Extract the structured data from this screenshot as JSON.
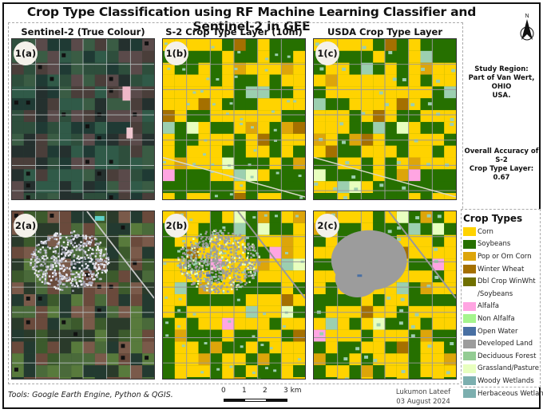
{
  "title": "Crop Type Classification using RF Machine Learning Classifier and Sentinel-2 in GEE",
  "north_arrow": {
    "label": "N",
    "icon": "north-arrow-icon"
  },
  "columns": [
    {
      "title": "Sentinel-2 (True Colour)"
    },
    {
      "title": "S-2 Crop Type Layer (10m)"
    },
    {
      "title": "USDA Crop Type Layer (30m)"
    }
  ],
  "panels": [
    {
      "label": "1(a)",
      "row": 1,
      "col": "a",
      "kind": "true-colour",
      "area": "rural fields"
    },
    {
      "label": "1(b)",
      "row": 1,
      "col": "b",
      "kind": "s2-classified",
      "area": "rural fields"
    },
    {
      "label": "1(c)",
      "row": 1,
      "col": "c",
      "kind": "usda-classified",
      "area": "rural fields"
    },
    {
      "label": "2(a)",
      "row": 2,
      "col": "a",
      "kind": "true-colour",
      "area": "town and fields"
    },
    {
      "label": "2(b)",
      "row": 2,
      "col": "b",
      "kind": "s2-classified",
      "area": "town and fields"
    },
    {
      "label": "2(c)",
      "row": 2,
      "col": "c",
      "kind": "usda-classified",
      "area": "town and fields"
    }
  ],
  "study_region": {
    "heading": "Study Region:",
    "line1": "Part of Van Wert, OHIO",
    "line2": "USA."
  },
  "accuracy": {
    "line1": "Overall Accuracy of S-2",
    "line2": "Crop Type Layer: 0.67",
    "value": 0.67
  },
  "legend": {
    "title": "Crop Types",
    "items": [
      {
        "label": "Corn",
        "color": "#ffd300"
      },
      {
        "label": "Soybeans",
        "color": "#267000"
      },
      {
        "label": "Pop or Orn Corn",
        "color": "#dda50a"
      },
      {
        "label": "Winter Wheat",
        "color": "#a57000"
      },
      {
        "label": "Dbl Crop WinWht",
        "color": "#707000"
      },
      {
        "label": "/Soybeans",
        "color": "",
        "continuation": true
      },
      {
        "label": "Alfalfa",
        "color": "#ffa5e2"
      },
      {
        "label": "Non Alfalfa",
        "color": "#a5f58d"
      },
      {
        "label": "Open Water",
        "color": "#4970a3"
      },
      {
        "label": "Developed Land",
        "color": "#9c9c9c"
      },
      {
        "label": "Deciduous Forest",
        "color": "#93cc93"
      },
      {
        "label": "Grassland/Pasture",
        "color": "#e8ffbf"
      },
      {
        "label": "Woody Wetlands",
        "color": "#7cafaf"
      },
      {
        "label": "Herbaceous Wetlands",
        "color": "#7cafaf"
      }
    ]
  },
  "footer": {
    "tools": "Tools: Google Earth Engine, Python & QGIS.",
    "scale": {
      "ticks": [
        "0",
        "1",
        "2",
        "3 km"
      ],
      "unit": "km"
    },
    "author": "Lukumon Lateef",
    "date": "03 August 2024"
  },
  "colors": {
    "road": "#9a9a9a",
    "developed": "#9c9c9c",
    "pale_field": "#9ccfb0",
    "grass": "#e8ffbf"
  }
}
